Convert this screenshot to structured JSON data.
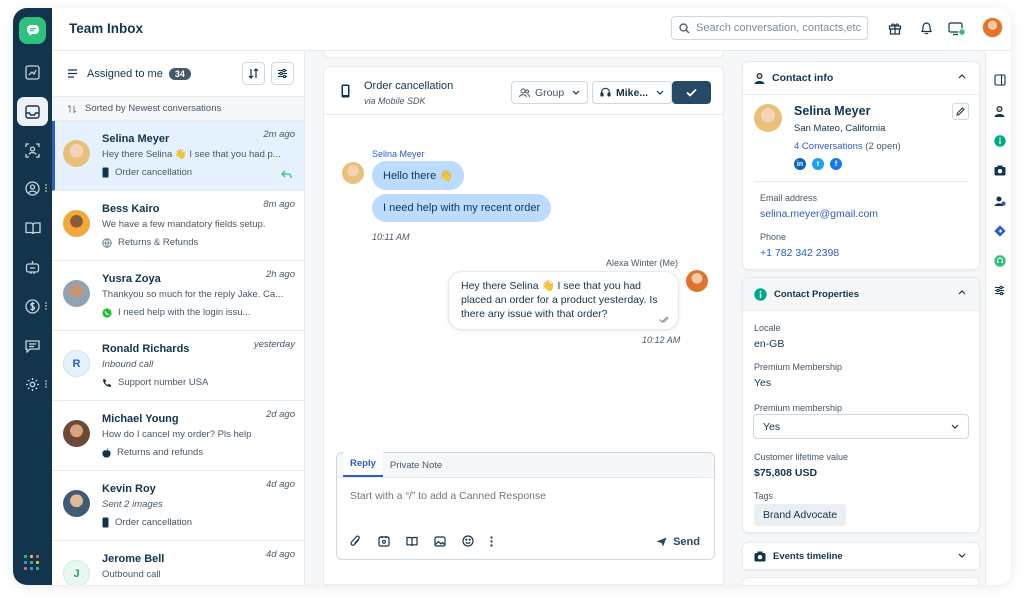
{
  "app": {
    "title": "Team Inbox"
  },
  "search": {
    "placeholder": "Search conversation, contacts,etc."
  },
  "nav_icons": [
    "chat-logo-icon",
    "dashboard-icon",
    "inbox-icon",
    "contacts-icon",
    "user-circle-icon",
    "book-icon",
    "bot-icon",
    "dollar-icon",
    "message-icon",
    "settings-icon",
    "apps-grid-icon"
  ],
  "colors": {
    "nav_bg": "#12344d",
    "accent": "#2c5cc5",
    "brand_green": "#2ec27e",
    "bubble_in": "#bbdcfe",
    "selected_row": "#e5f2fd",
    "primary_button": "#264966"
  },
  "list": {
    "filter_label": "Assigned to me",
    "filter_count": "34",
    "sort_label": "Sorted by Newest conversations",
    "conversations": [
      {
        "name": "Selina Meyer",
        "time": "2m ago",
        "preview": "Hey there Selina 👋 I see that you had p...",
        "meta": "Order cancellation",
        "meta_icon": "mobile-icon"
      },
      {
        "name": "Bess Kairo",
        "time": "8m ago",
        "preview": "We have a few mandatory fields setup.",
        "meta": "Returns & Refunds",
        "meta_icon": "globe-icon"
      },
      {
        "name": "Yusra Zoya",
        "time": "2h ago",
        "preview": "Thankyou so much for the reply Jake. Ca...",
        "meta": "I need help with the login issu...",
        "meta_icon": "whatsapp-icon"
      },
      {
        "name": "Ronald Richards",
        "time": "yesterday",
        "preview": "Inbound call",
        "meta": "Support number USA",
        "meta_icon": "phone-icon",
        "initial": "R"
      },
      {
        "name": "Michael Young",
        "time": "2d ago",
        "preview": "How do I cancel my order? Pls help",
        "meta": "Returns and refunds",
        "meta_icon": "apple-icon"
      },
      {
        "name": "Kevin Roy",
        "time": "4d ago",
        "preview": "Sent 2 images",
        "meta": "Order cancellation",
        "meta_icon": "mobile-icon"
      },
      {
        "name": "Jerome Bell",
        "time": "4d ago",
        "preview": "Outbound call",
        "initial": "J"
      }
    ]
  },
  "chat": {
    "title": "Order cancellation",
    "subtitle": "via Mobile SDK",
    "group_select": "Group",
    "agent_select": "Mike...",
    "incoming_sender": "Selina Meyer",
    "incoming_messages": [
      "Hello there 👋",
      "I need help with my recent order"
    ],
    "incoming_time": "10:11 AM",
    "outgoing_sender": "Alexa Winter (Me)",
    "outgoing_message": "Hey there Selina 👋 I see that you had placed an order for a product yesterday. Is there any issue with that order?",
    "outgoing_time": "10:12 AM"
  },
  "composer": {
    "tab_reply": "Reply",
    "tab_note": "Private Note",
    "placeholder": "Start with a “/” to add a Canned Response",
    "send_label": "Send"
  },
  "contact": {
    "header": "Contact info",
    "name": "Selina Meyer",
    "location": "San Mateo, California",
    "conversations_link": "4 Conversations",
    "conversations_open": "(2 open)",
    "email_label": "Email address",
    "email": "selina.meyer@gmail.com",
    "phone_label": "Phone",
    "phone": "+1 782 342 2398"
  },
  "properties": {
    "header": "Contact Properties",
    "locale_label": "Locale",
    "locale_value": "en-GB",
    "premium1_label": "Premium Membership",
    "premium1_value": "Yes",
    "premium2_label": "Premium membership",
    "premium2_value": "Yes",
    "ltv_label": "Customer lifetime value",
    "ltv_value": "$75,808 USD",
    "tags_label": "Tags",
    "tag": "Brand Advocate"
  },
  "events": {
    "header": "Events timeline"
  }
}
